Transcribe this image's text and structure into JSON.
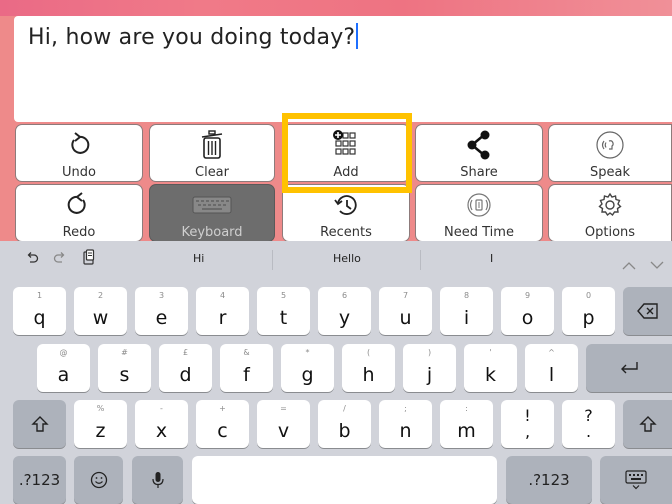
{
  "message": {
    "text": "Hi, how are you doing today?"
  },
  "tiles": {
    "undo": "Undo",
    "clear": "Clear",
    "add": "Add",
    "share": "Share",
    "speak": "Speak",
    "redo": "Redo",
    "keyboard": "Keyboard",
    "recents": "Recents",
    "need_time": "Need Time",
    "options": "Options"
  },
  "suggestions": [
    "Hi",
    "Hello",
    "I"
  ],
  "keyboard": {
    "row1": [
      {
        "alt": "1",
        "key": "q"
      },
      {
        "alt": "2",
        "key": "w"
      },
      {
        "alt": "3",
        "key": "e"
      },
      {
        "alt": "4",
        "key": "r"
      },
      {
        "alt": "5",
        "key": "t"
      },
      {
        "alt": "6",
        "key": "y"
      },
      {
        "alt": "7",
        "key": "u"
      },
      {
        "alt": "8",
        "key": "i"
      },
      {
        "alt": "9",
        "key": "o"
      },
      {
        "alt": "0",
        "key": "p"
      }
    ],
    "row2": [
      {
        "alt": "@",
        "key": "a"
      },
      {
        "alt": "#",
        "key": "s"
      },
      {
        "alt": "£",
        "key": "d"
      },
      {
        "alt": "&",
        "key": "f"
      },
      {
        "alt": "*",
        "key": "g"
      },
      {
        "alt": "(",
        "key": "h"
      },
      {
        "alt": ")",
        "key": "j"
      },
      {
        "alt": "'",
        "key": "k"
      },
      {
        "alt": "^",
        "key": "l"
      }
    ],
    "row3": [
      {
        "alt": "%",
        "key": "z"
      },
      {
        "alt": "-",
        "key": "x"
      },
      {
        "alt": "+",
        "key": "c"
      },
      {
        "alt": "=",
        "key": "v"
      },
      {
        "alt": "/",
        "key": "b"
      },
      {
        "alt": ";",
        "key": "n"
      },
      {
        "alt": ":",
        "key": "m"
      }
    ],
    "punct1": {
      "top": "!",
      "bottom": ","
    },
    "punct2": {
      "top": "?",
      "bottom": "."
    },
    "numbers_label": ".?123"
  },
  "colors": {
    "background": "#ee8a8a",
    "highlight": "#ffc200",
    "caret": "#1e6fff"
  }
}
